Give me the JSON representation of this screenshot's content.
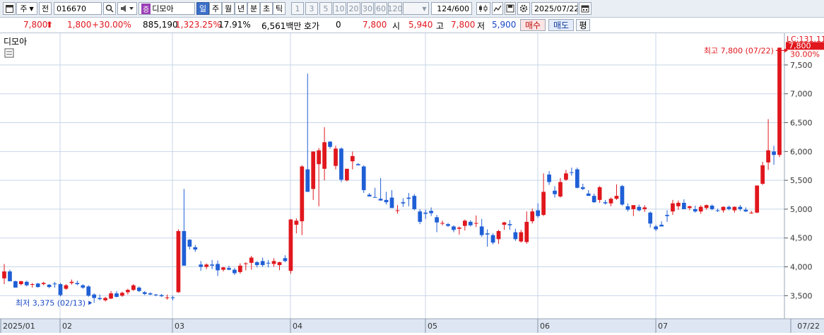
{
  "toolbar": {
    "market": "주",
    "prefix": "전",
    "code": "016670",
    "name_tag": "증",
    "name": "디모아",
    "periods": [
      "일",
      "주",
      "월",
      "년",
      "분",
      "초",
      "틱"
    ],
    "selected_period": "일",
    "intervals": [
      "1",
      "3",
      "5",
      "10",
      "20",
      "30",
      "60",
      "120"
    ],
    "count": "124",
    "count_total": "/600",
    "date": "2025/07/22"
  },
  "quote": {
    "price": "7,800",
    "price_arrow": "⬆",
    "change": "1,800",
    "change_pct": "+30.00%",
    "volume": "885,190",
    "volume_ratio": "1,323.25%",
    "turnover": "17.91%",
    "amount": "6,561백만",
    "hoga_label": "호가",
    "hoga_value": "0",
    "hoga_price": "7,800",
    "open_label": "시",
    "open": "5,940",
    "high_label": "고",
    "high": "7,800",
    "low_label": "저",
    "low": "5,900",
    "buy": "매수",
    "sell": "매도",
    "eval": "평"
  },
  "chart_label": "디모아",
  "lc_label": "LC:131.11",
  "price_tag": "7,800",
  "pct_tag": "30.00%",
  "colors": {
    "up": "#e0171d",
    "down": "#1f5fd6",
    "grid": "#c8d6e8",
    "axis_bg": "#dde6f2"
  },
  "chart_data": {
    "type": "candlestick",
    "ylim": [
      3100,
      8050
    ],
    "y_ticks": [
      3500,
      4000,
      4500,
      5000,
      5500,
      6000,
      6500,
      7000,
      7500
    ],
    "y_tick_labels": [
      "3,500",
      "4,000",
      "4,500",
      "5,000",
      "5,500",
      "6,000",
      "6,500",
      "7,000",
      "7,500"
    ],
    "x_labels": [
      {
        "index": 0,
        "label": "2025/01"
      },
      {
        "index": 10,
        "label": "02"
      },
      {
        "index": 30,
        "label": "03"
      },
      {
        "index": 51,
        "label": "04"
      },
      {
        "index": 75,
        "label": "05"
      },
      {
        "index": 95,
        "label": "06"
      },
      {
        "index": 116,
        "label": "07"
      },
      {
        "index": 140,
        "label": "07/22"
      }
    ],
    "series": [
      {
        "name": "",
        "values": [
          [
            3800,
            4050,
            3700,
            3920
          ],
          [
            3920,
            3950,
            3750,
            3750
          ],
          [
            3750,
            3760,
            3640,
            3640
          ],
          [
            3700,
            3760,
            3680,
            3750
          ],
          [
            3740,
            3760,
            3660,
            3680
          ],
          [
            3690,
            3720,
            3640,
            3700
          ],
          [
            3710,
            3720,
            3640,
            3650
          ],
          [
            3700,
            3740,
            3680,
            3720
          ],
          [
            3690,
            3700,
            3630,
            3650
          ],
          [
            3710,
            3740,
            3640,
            3700
          ],
          [
            3700,
            3720,
            3490,
            3510
          ],
          [
            3620,
            3700,
            3600,
            3680
          ],
          [
            3720,
            3780,
            3690,
            3740
          ],
          [
            3720,
            3760,
            3680,
            3700
          ],
          [
            3680,
            3700,
            3620,
            3640
          ],
          [
            3660,
            3680,
            3480,
            3500
          ],
          [
            3520,
            3540,
            3375,
            3460
          ],
          [
            3460,
            3520,
            3420,
            3440
          ],
          [
            3420,
            3480,
            3400,
            3460
          ],
          [
            3450,
            3580,
            3440,
            3540
          ],
          [
            3540,
            3580,
            3470,
            3480
          ],
          [
            3500,
            3570,
            3480,
            3550
          ],
          [
            3560,
            3620,
            3520,
            3600
          ],
          [
            3600,
            3700,
            3580,
            3680
          ],
          [
            3640,
            3660,
            3560,
            3580
          ],
          [
            3560,
            3580,
            3510,
            3530
          ],
          [
            3540,
            3560,
            3510,
            3520
          ],
          [
            3520,
            3530,
            3490,
            3510
          ],
          [
            3510,
            3530,
            3480,
            3490
          ],
          [
            3460,
            3520,
            3430,
            3470
          ],
          [
            3470,
            3500,
            3420,
            3460
          ],
          [
            3560,
            4650,
            3550,
            4620
          ],
          [
            4620,
            5350,
            4030,
            4020
          ],
          [
            4470,
            4480,
            4300,
            4350
          ],
          [
            4340,
            4380,
            4260,
            4300
          ],
          [
            4040,
            4100,
            3930,
            4000
          ],
          [
            4000,
            4060,
            3960,
            4040
          ],
          [
            4040,
            4120,
            3960,
            4020
          ],
          [
            4050,
            4110,
            3840,
            3940
          ],
          [
            3950,
            4000,
            3920,
            3990
          ],
          [
            3980,
            4020,
            3940,
            3950
          ],
          [
            3950,
            3980,
            3860,
            3890
          ],
          [
            3910,
            4060,
            3880,
            4020
          ],
          [
            4050,
            4080,
            3940,
            4060
          ],
          [
            4070,
            4190,
            3950,
            4160
          ],
          [
            4080,
            4100,
            3990,
            4030
          ],
          [
            4100,
            4160,
            4000,
            4030
          ],
          [
            4070,
            4120,
            3990,
            4060
          ],
          [
            4050,
            4150,
            4000,
            4100
          ],
          [
            4030,
            4090,
            3940,
            4080
          ],
          [
            4150,
            4200,
            4080,
            4100
          ],
          [
            3930,
            4830,
            3880,
            4820
          ],
          [
            4730,
            4840,
            4580,
            4800
          ],
          [
            4790,
            5760,
            4550,
            5740
          ],
          [
            5690,
            7350,
            5660,
            5300
          ],
          [
            5350,
            6000,
            5160,
            6000
          ],
          [
            5780,
            6060,
            5050,
            6020
          ],
          [
            5700,
            6420,
            5500,
            6160
          ],
          [
            6170,
            6180,
            6050,
            6080
          ],
          [
            5750,
            6100,
            5690,
            6050
          ],
          [
            6050,
            6070,
            5470,
            5510
          ],
          [
            5500,
            5690,
            5480,
            5700
          ],
          [
            5830,
            6000,
            5690,
            5920
          ],
          [
            5780,
            5800,
            5760,
            5760
          ],
          [
            5740,
            5760,
            5280,
            5330
          ],
          [
            5250,
            5280,
            5240,
            5220
          ],
          [
            5210,
            5370,
            5200,
            5200
          ],
          [
            5180,
            5540,
            5150,
            5150
          ],
          [
            5160,
            5300,
            5080,
            5120
          ],
          [
            5200,
            5330,
            5050,
            5020
          ],
          [
            4980,
            5070,
            4920,
            4980
          ],
          [
            5120,
            5190,
            5040,
            5100
          ],
          [
            5200,
            5280,
            5050,
            5180
          ],
          [
            5230,
            5260,
            4980,
            5000
          ],
          [
            4960,
            5000,
            4740,
            4780
          ],
          [
            4940,
            4990,
            4830,
            4920
          ],
          [
            4970,
            5030,
            4880,
            4930
          ],
          [
            4860,
            4900,
            4600,
            4770
          ],
          [
            4760,
            4800,
            4720,
            4760
          ],
          [
            4740,
            4760,
            4690,
            4710
          ],
          [
            4700,
            4720,
            4600,
            4640
          ],
          [
            4660,
            4700,
            4560,
            4680
          ],
          [
            4710,
            4820,
            4630,
            4800
          ],
          [
            4780,
            4810,
            4700,
            4720
          ],
          [
            4760,
            4890,
            4690,
            4760
          ],
          [
            4700,
            4830,
            4520,
            4550
          ],
          [
            4580,
            4650,
            4350,
            4560
          ],
          [
            4550,
            4580,
            4390,
            4420
          ],
          [
            4480,
            4640,
            4400,
            4620
          ],
          [
            4730,
            4780,
            4640,
            4770
          ],
          [
            4740,
            4810,
            4640,
            4720
          ],
          [
            4600,
            4660,
            4450,
            4480
          ],
          [
            4440,
            4640,
            4420,
            4600
          ],
          [
            4430,
            4960,
            4400,
            4780
          ],
          [
            4790,
            5010,
            4750,
            4960
          ],
          [
            4980,
            5100,
            4850,
            4880
          ],
          [
            4900,
            5620,
            4880,
            5300
          ],
          [
            5600,
            5660,
            5420,
            5470
          ],
          [
            5320,
            5400,
            5200,
            5260
          ],
          [
            5220,
            5540,
            5200,
            5470
          ],
          [
            5510,
            5680,
            5490,
            5620
          ],
          [
            5640,
            5720,
            5580,
            5630
          ],
          [
            5690,
            5720,
            5360,
            5370
          ],
          [
            5380,
            5440,
            5330,
            5350
          ],
          [
            5270,
            5330,
            5230,
            5230
          ],
          [
            5230,
            5270,
            5110,
            5120
          ],
          [
            5160,
            5400,
            5110,
            5380
          ],
          [
            5120,
            5160,
            5080,
            5100
          ],
          [
            5100,
            5200,
            5050,
            5180
          ],
          [
            5180,
            5430,
            5160,
            5230
          ],
          [
            5400,
            5420,
            5060,
            5080
          ],
          [
            5050,
            5100,
            4960,
            4990
          ],
          [
            5000,
            5060,
            4880,
            5070
          ],
          [
            5040,
            5080,
            4960,
            4980
          ],
          [
            5000,
            5070,
            4950,
            5030
          ],
          [
            4940,
            4960,
            4680,
            4750
          ],
          [
            4700,
            4730,
            4620,
            4650
          ],
          [
            4730,
            4790,
            4700,
            4700
          ],
          [
            4900,
            4980,
            4780,
            4880
          ],
          [
            4960,
            5160,
            4900,
            5100
          ],
          [
            5050,
            5150,
            4990,
            5110
          ],
          [
            5110,
            5170,
            5000,
            5000
          ],
          [
            5020,
            5060,
            4980,
            5050
          ],
          [
            5000,
            5060,
            4940,
            4960
          ],
          [
            4960,
            5070,
            4920,
            5040
          ],
          [
            5020,
            5080,
            4990,
            5070
          ],
          [
            5060,
            5080,
            4980,
            5000
          ],
          [
            4980,
            5010,
            4950,
            4970
          ],
          [
            4980,
            5050,
            4940,
            5040
          ],
          [
            5040,
            5060,
            4980,
            5000
          ],
          [
            4980,
            5050,
            4940,
            5040
          ],
          [
            5040,
            5070,
            4970,
            5000
          ],
          [
            4990,
            5030,
            4950,
            4960
          ],
          [
            4940,
            4970,
            4920,
            4940
          ],
          [
            4940,
            5410,
            4930,
            5410
          ],
          [
            5440,
            5820,
            5420,
            5760
          ],
          [
            5810,
            6560,
            5680,
            6020
          ],
          [
            6000,
            6100,
            5770,
            5940
          ],
          [
            5940,
            7800,
            5900,
            7800
          ]
        ]
      }
    ],
    "ohlc_order": [
      "open",
      "high",
      "low",
      "close"
    ],
    "annotations": {
      "max": {
        "index": 140,
        "value": 7800,
        "text": "최고 7,800 (07/22)"
      },
      "min": {
        "index": 16,
        "value": 3375,
        "text": "최저 3,375 (02/13)"
      }
    }
  }
}
